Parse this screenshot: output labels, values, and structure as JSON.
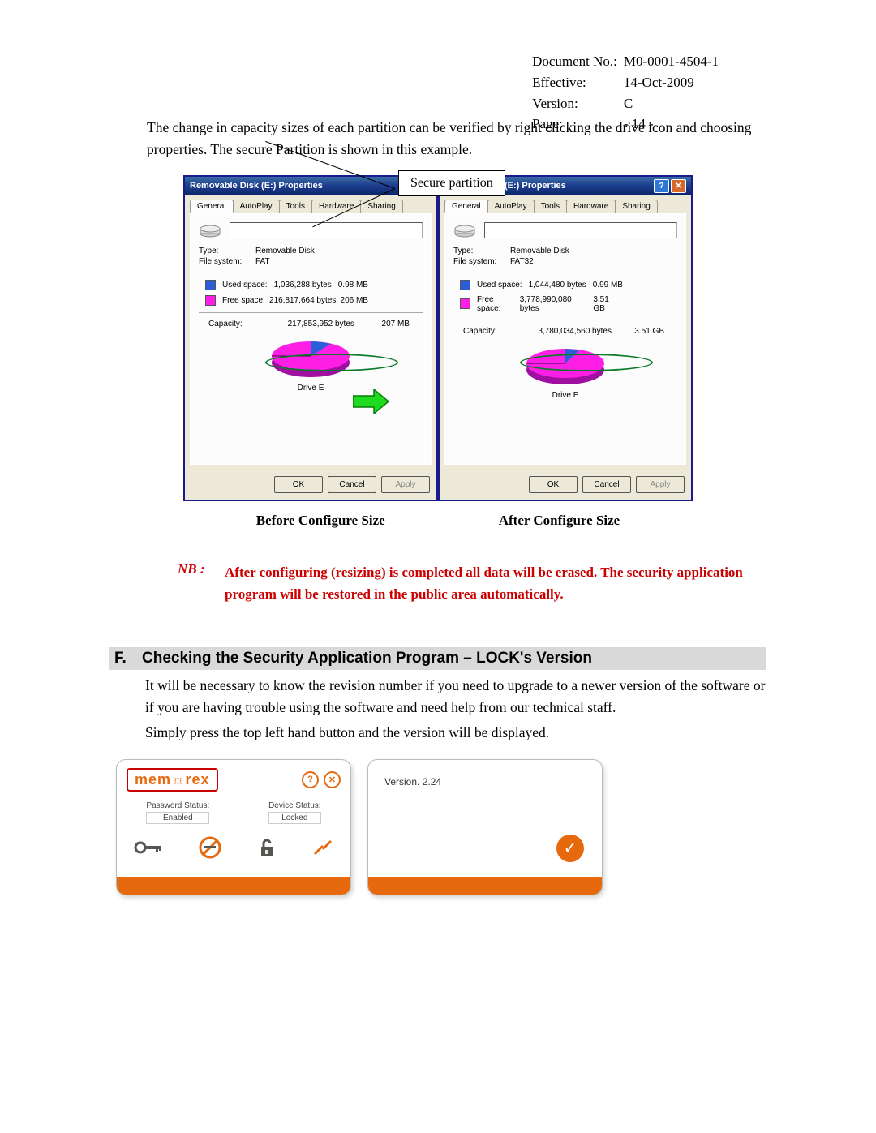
{
  "header": {
    "doc": "Document No.:",
    "doc_v": "M0-0001-4504-1",
    "eff": "Effective:",
    "eff_v": "14-Oct-2009",
    "ver": "Version:",
    "ver_v": "C",
    "page": "Page:",
    "page_v": "- 14 -"
  },
  "para1": "The change in capacity sizes of each partition can be verified by right clicking the drive icon and choosing properties.    The secure Partition is shown in this example.",
  "callout": "Secure partition",
  "winL": {
    "title": "Removable Disk (E:) Properties",
    "tabs": [
      "General",
      "AutoPlay",
      "Tools",
      "Hardware",
      "Sharing"
    ],
    "type_k": "Type:",
    "type_v": "Removable Disk",
    "fs_k": "File system:",
    "fs_v": "FAT",
    "used_k": "Used space:",
    "used_b": "1,036,288 bytes",
    "used_h": "0.98 MB",
    "free_k": "Free space:",
    "free_b": "216,817,664 bytes",
    "free_h": "206 MB",
    "cap_k": "Capacity:",
    "cap_b": "217,853,952 bytes",
    "cap_h": "207 MB",
    "drive": "Drive E",
    "ok": "OK",
    "cancel": "Cancel",
    "apply": "Apply"
  },
  "winR": {
    "title": "movable Disk (E:) Properties",
    "tabs": [
      "General",
      "AutoPlay",
      "Tools",
      "Hardware",
      "Sharing"
    ],
    "type_k": "Type:",
    "type_v": "Removable Disk",
    "fs_k": "File system:",
    "fs_v": "FAT32",
    "used_k": "Used space:",
    "used_b": "1,044,480 bytes",
    "used_h": "0.99 MB",
    "free_k": "Free space:",
    "free_b": "3,778,990,080 bytes",
    "free_h": "3.51 GB",
    "cap_k": "Capacity:",
    "cap_b": "3,780,034,560 bytes",
    "cap_h": "3.51 GB",
    "drive": "Drive E",
    "ok": "OK",
    "cancel": "Cancel",
    "apply": "Apply"
  },
  "cap_before": "Before Configure Size",
  "cap_after": "After Configure Size",
  "nb_label": "NB :",
  "nb_text": "After configuring (resizing) is completed all data will be erased. The security application program will be restored in the public area automatically.",
  "sec_letter": "F.",
  "sec_title": "Checking the Security Application Program – LOCK's Version",
  "sec_body1": "It will be necessary to know the revision number if you need to upgrade to a newer version of the software or if you are having trouble using the software and need help from our technical staff.",
  "sec_body2": "Simply press the top left hand button and the version will be displayed.",
  "mem": {
    "logo": "mem☼rex",
    "help": "?",
    "close": "✕",
    "pw_k": "Password Status:",
    "pw_v": "Enabled",
    "dev_k": "Device Status:",
    "dev_v": "Locked",
    "ver": "Version. 2.24",
    "check": "✓"
  }
}
